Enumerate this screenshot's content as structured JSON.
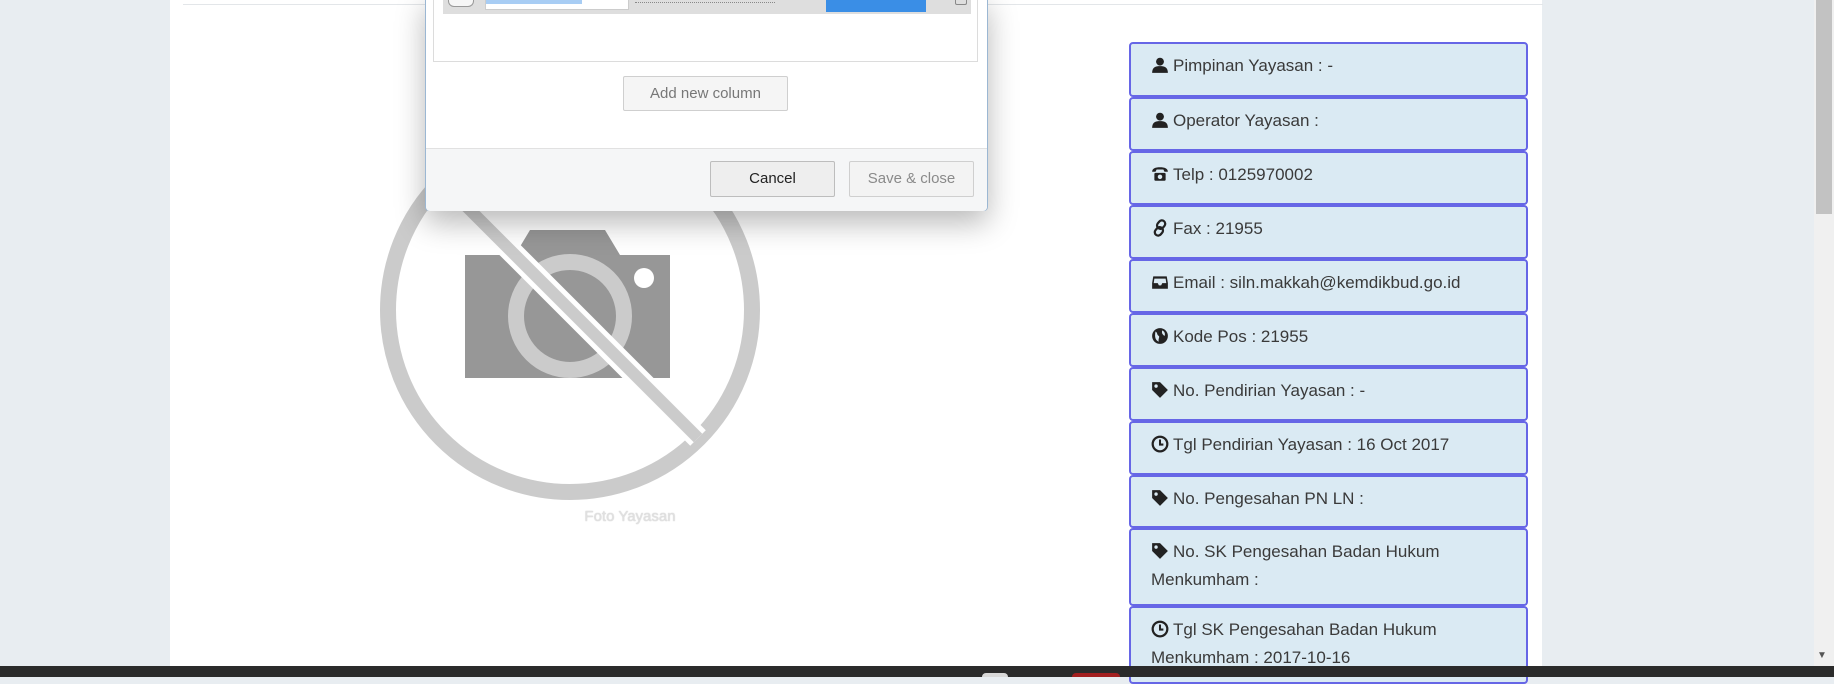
{
  "photo": {
    "caption": "Foto Yayasan"
  },
  "info": [
    {
      "icon": "user-icon",
      "label": "Pimpinan Yayasan : -"
    },
    {
      "icon": "user-icon",
      "label": "Operator Yayasan :"
    },
    {
      "icon": "phone-icon",
      "label": "Telp : 0125970002"
    },
    {
      "icon": "link-icon",
      "label": "Fax : 21955"
    },
    {
      "icon": "inbox-icon",
      "label": "Email : siln.makkah@kemdikbud.go.id"
    },
    {
      "icon": "globe-icon",
      "label": "Kode Pos : 21955"
    },
    {
      "icon": "tag-icon",
      "label": "No. Pendirian Yayasan : -"
    },
    {
      "icon": "clock-icon",
      "label": "Tgl Pendirian Yayasan : 16 Oct 2017"
    },
    {
      "icon": "tag-icon",
      "label": "No. Pengesahan PN LN :"
    },
    {
      "icon": "tag-icon",
      "label": "No. SK Pengesahan Badan Hukum Menkumham :"
    },
    {
      "icon": "clock-icon",
      "label": "Tgl SK Pengesahan Badan Hukum Menkumham : 2017-10-16"
    }
  ],
  "dialog": {
    "add_column_label": "Add new column",
    "cancel_label": "Cancel",
    "save_close_label": "Save & close"
  },
  "colors": {
    "info_bg": "#daeaf3",
    "info_border": "#6666e6",
    "accent_blue": "#3a8ee6"
  }
}
